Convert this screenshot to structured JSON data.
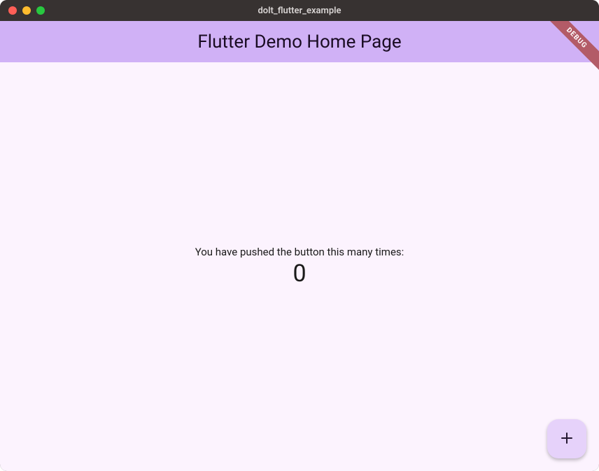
{
  "window": {
    "title": "dolt_flutter_example"
  },
  "appbar": {
    "title": "Flutter Demo Home Page"
  },
  "debug": {
    "label": "DEBUG"
  },
  "counter": {
    "label": "You have pushed the button this many times:",
    "value": "0"
  },
  "fab": {
    "icon_name": "plus-icon"
  },
  "colors": {
    "appbar_bg": "#d0b1f6",
    "body_bg": "#fcf3fe",
    "fab_bg": "#e6d2fa",
    "debug_bg": "#b35b67"
  }
}
